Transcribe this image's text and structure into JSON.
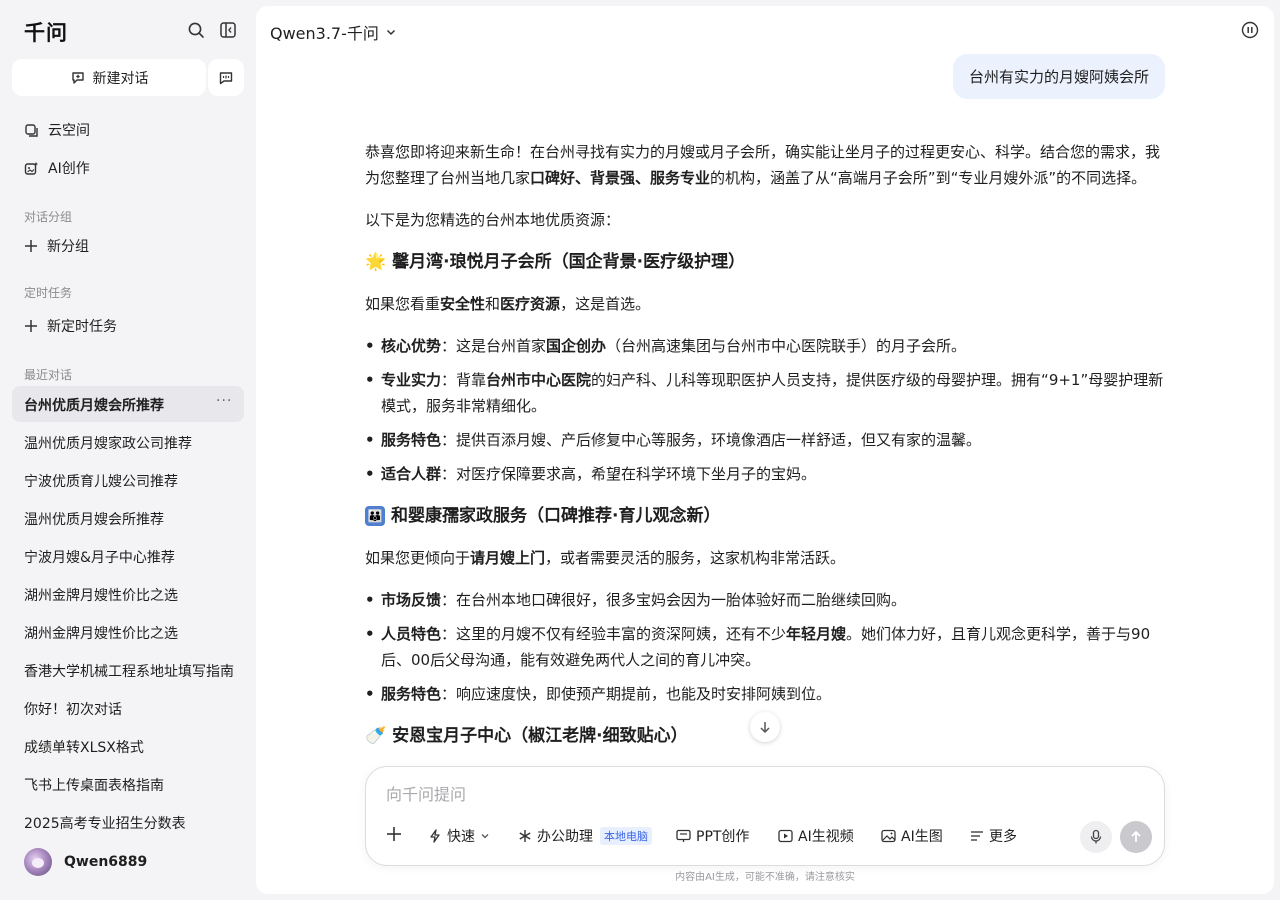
{
  "sidebar": {
    "logo": "千问",
    "new_chat_label": "新建对话",
    "nav": [
      {
        "label": "云空间",
        "icon": "cloud-space-icon"
      },
      {
        "label": "AI创作",
        "icon": "ai-create-icon"
      }
    ],
    "group_section": {
      "title": "对话分组",
      "new_label": "新分组"
    },
    "task_section": {
      "title": "定时任务",
      "new_label": "新定时任务"
    },
    "recent_title": "最近对话",
    "history": [
      "台州优质月嫂会所推荐",
      "温州优质月嫂家政公司推荐",
      "宁波优质育儿嫂公司推荐",
      "温州优质月嫂会所推荐",
      "宁波月嫂&月子中心推荐",
      "湖州金牌月嫂性价比之选",
      "湖州金牌月嫂性价比之选",
      "香港大学机械工程系地址填写指南",
      "你好！初次对话",
      "成绩单转XLSX格式",
      "飞书上传桌面表格指南",
      "2025高考专业招生分数表"
    ],
    "more_label": "···",
    "user_name": "Qwen6889"
  },
  "header": {
    "model": "Qwen3.7-千问"
  },
  "conversation": {
    "user_message": "台州有实力的月嫂阿姨会所",
    "answer": {
      "intro_1": "恭喜您即将迎来新生命！在台州寻找有实力的月嫂或月子会所，确实能让坐月子的过程更安心、科学。结合您的需求，我为您整理了台州当地几家",
      "intro_bold": "口碑好、背景强、服务专业",
      "intro_2": "的机构，涵盖了从“高端月子会所”到“专业月嫂外派”的不同选择。",
      "lead": "以下是为您精选的台州本地优质资源：",
      "s1": {
        "emoji": "🌟",
        "title": "馨月湾·琅悦月子会所（国企背景·医疗级护理）",
        "p1": "如果您看重",
        "p_b1": "安全性",
        "p2": "和",
        "p_b2": "医疗资源",
        "p3": "，这是首选。",
        "i1_k": "核心优势",
        "i1_a": "：这是台州首家",
        "i1_b": "国企创办",
        "i1_c": "（台州高速集团与台州市中心医院联手）的月子会所。",
        "i2_k": "专业实力",
        "i2_a": "：背靠",
        "i2_b": "台州市中心医院",
        "i2_c": "的妇产科、儿科等现职医护人员支持，提供医疗级的母婴护理。拥有“9+1”母婴护理新模式，服务非常精细化。",
        "i3_k": "服务特色",
        "i3_a": "：提供百添月嫂、产后修复中心等服务，环境像酒店一样舒适，但又有家的温馨。",
        "i4_k": "适合人群",
        "i4_a": "：对医疗保障要求高，希望在科学环境下坐月子的宝妈。"
      },
      "s2": {
        "emoji": "👨‍👩‍👧",
        "title": "和婴康孺家政服务（口碑推荐·育儿观念新）",
        "p1": "如果您更倾向于",
        "p_b1": "请月嫂上门",
        "p2": "，或者需要灵活的服务，这家机构非常活跃。",
        "i1_k": "市场反馈",
        "i1_a": "：在台州本地口碑很好，很多宝妈会因为一胎体验好而二胎继续回购。",
        "i2_k": "人员特色",
        "i2_a": "：这里的月嫂不仅有经验丰富的资深阿姨，还有不少",
        "i2_b": "年轻月嫂",
        "i2_c": "。她们体力好，且育儿观念更科学，善于与90后、00后父母沟通，能有效避免两代人之间的育儿冲突。",
        "i3_k": "服务特色",
        "i3_a": "：响应速度快，即使预产期提前，也能及时安排阿姨到位。"
      },
      "s3": {
        "emoji": "🍼",
        "title": "安恩宝月子中心（椒江老牌·细致贴心）"
      }
    }
  },
  "composer": {
    "placeholder": "向千问提问",
    "tools": {
      "mode": "快速",
      "office": "办公助理",
      "office_badge": "本地电脑",
      "ppt": "PPT创作",
      "video": "AI生视频",
      "image": "AI生图",
      "more": "更多"
    }
  },
  "disclaimer": "内容由AI生成，可能不准确，请注意核实"
}
